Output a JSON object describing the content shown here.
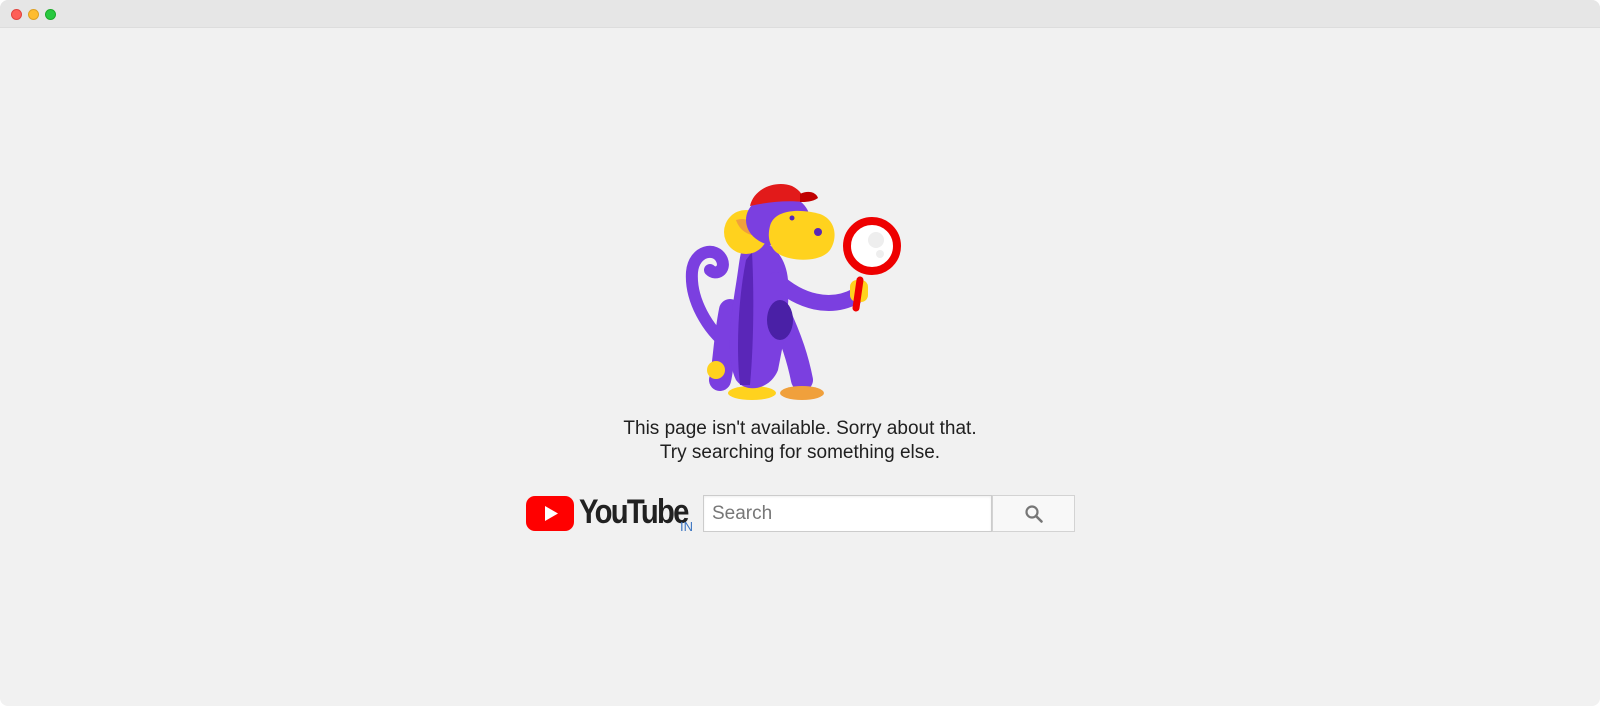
{
  "window": {
    "traffic_lights": [
      "close",
      "minimize",
      "zoom"
    ]
  },
  "illustration": {
    "icon": "monkey-with-magnifying-glass-icon"
  },
  "message": {
    "line1": "This page isn't available. Sorry about that.",
    "line2": "Try searching for something else."
  },
  "logo": {
    "text": "YouTube",
    "country": "IN",
    "icon": "youtube-play-icon"
  },
  "search": {
    "placeholder": "Search",
    "value": "",
    "button_icon": "search-icon"
  },
  "colors": {
    "background": "#f1f1f1",
    "brand_red": "#ff0000",
    "monkey_purple": "#7b3fe0",
    "monkey_yellow": "#ffd21e",
    "country_blue": "#3d76c2"
  }
}
